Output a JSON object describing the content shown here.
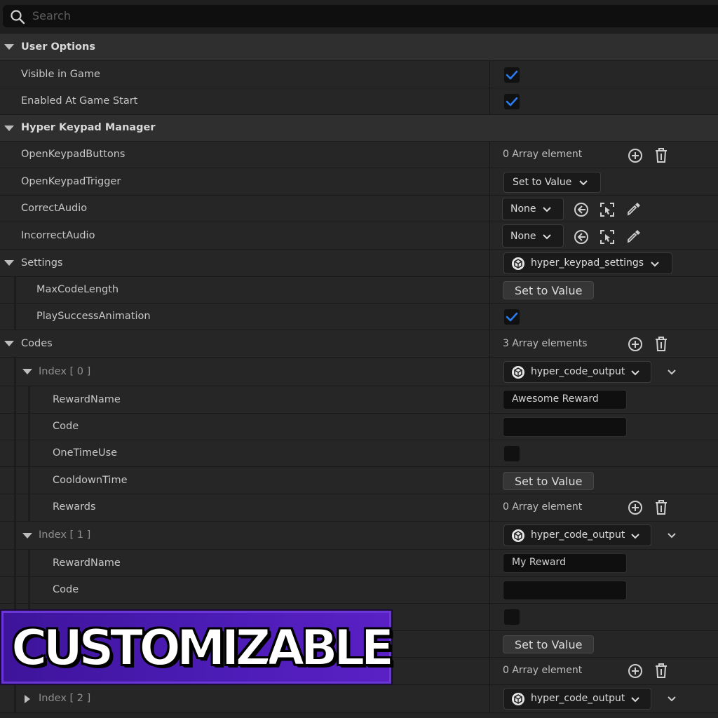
{
  "search": {
    "placeholder": "Search"
  },
  "user_options": {
    "header": "User Options",
    "visible_in_game": {
      "label": "Visible in Game",
      "checked": true
    },
    "enabled_at_start": {
      "label": "Enabled At Game Start",
      "checked": true
    }
  },
  "manager": {
    "header": "Hyper Keypad Manager",
    "open_buttons": {
      "label": "OpenKeypadButtons",
      "value": "0 Array element"
    },
    "open_trigger": {
      "label": "OpenKeypadTrigger",
      "button": "Set to Value"
    },
    "correct_audio": {
      "label": "CorrectAudio",
      "value": "None"
    },
    "incorrect_audio": {
      "label": "IncorrectAudio",
      "value": "None"
    }
  },
  "settings": {
    "label": "Settings",
    "asset": "hyper_keypad_settings",
    "max_code_length": {
      "label": "MaxCodeLength",
      "button": "Set to Value"
    },
    "play_success": {
      "label": "PlaySuccessAnimation",
      "checked": true
    }
  },
  "codes": {
    "label": "Codes",
    "count": "3 Array elements",
    "items": [
      {
        "index": "Index [ 0 ]",
        "asset": "hyper_code_output",
        "reward_name": {
          "label": "RewardName",
          "value": "Awesome Reward"
        },
        "code": {
          "label": "Code",
          "value": ""
        },
        "one_time_use": {
          "label": "OneTimeUse",
          "checked": false
        },
        "cooldown": {
          "label": "CooldownTime",
          "button": "Set to Value"
        },
        "rewards": {
          "label": "Rewards",
          "value": "0 Array element"
        }
      },
      {
        "index": "Index [ 1 ]",
        "asset": "hyper_code_output",
        "reward_name": {
          "label": "RewardName",
          "value": "My Reward"
        },
        "code": {
          "label": "Code",
          "value": ""
        },
        "one_time_use": {
          "checked": false
        },
        "cooldown": {
          "button": "Set to Value"
        },
        "rewards": {
          "value": "0 Array element"
        }
      },
      {
        "index": "Index [ 2 ]",
        "asset": "hyper_code_output"
      }
    ]
  },
  "banner": {
    "text": "CUSTOMIZABLE"
  },
  "colors": {
    "accent": "#2b7cf0",
    "banner": "#4c1cb6"
  }
}
